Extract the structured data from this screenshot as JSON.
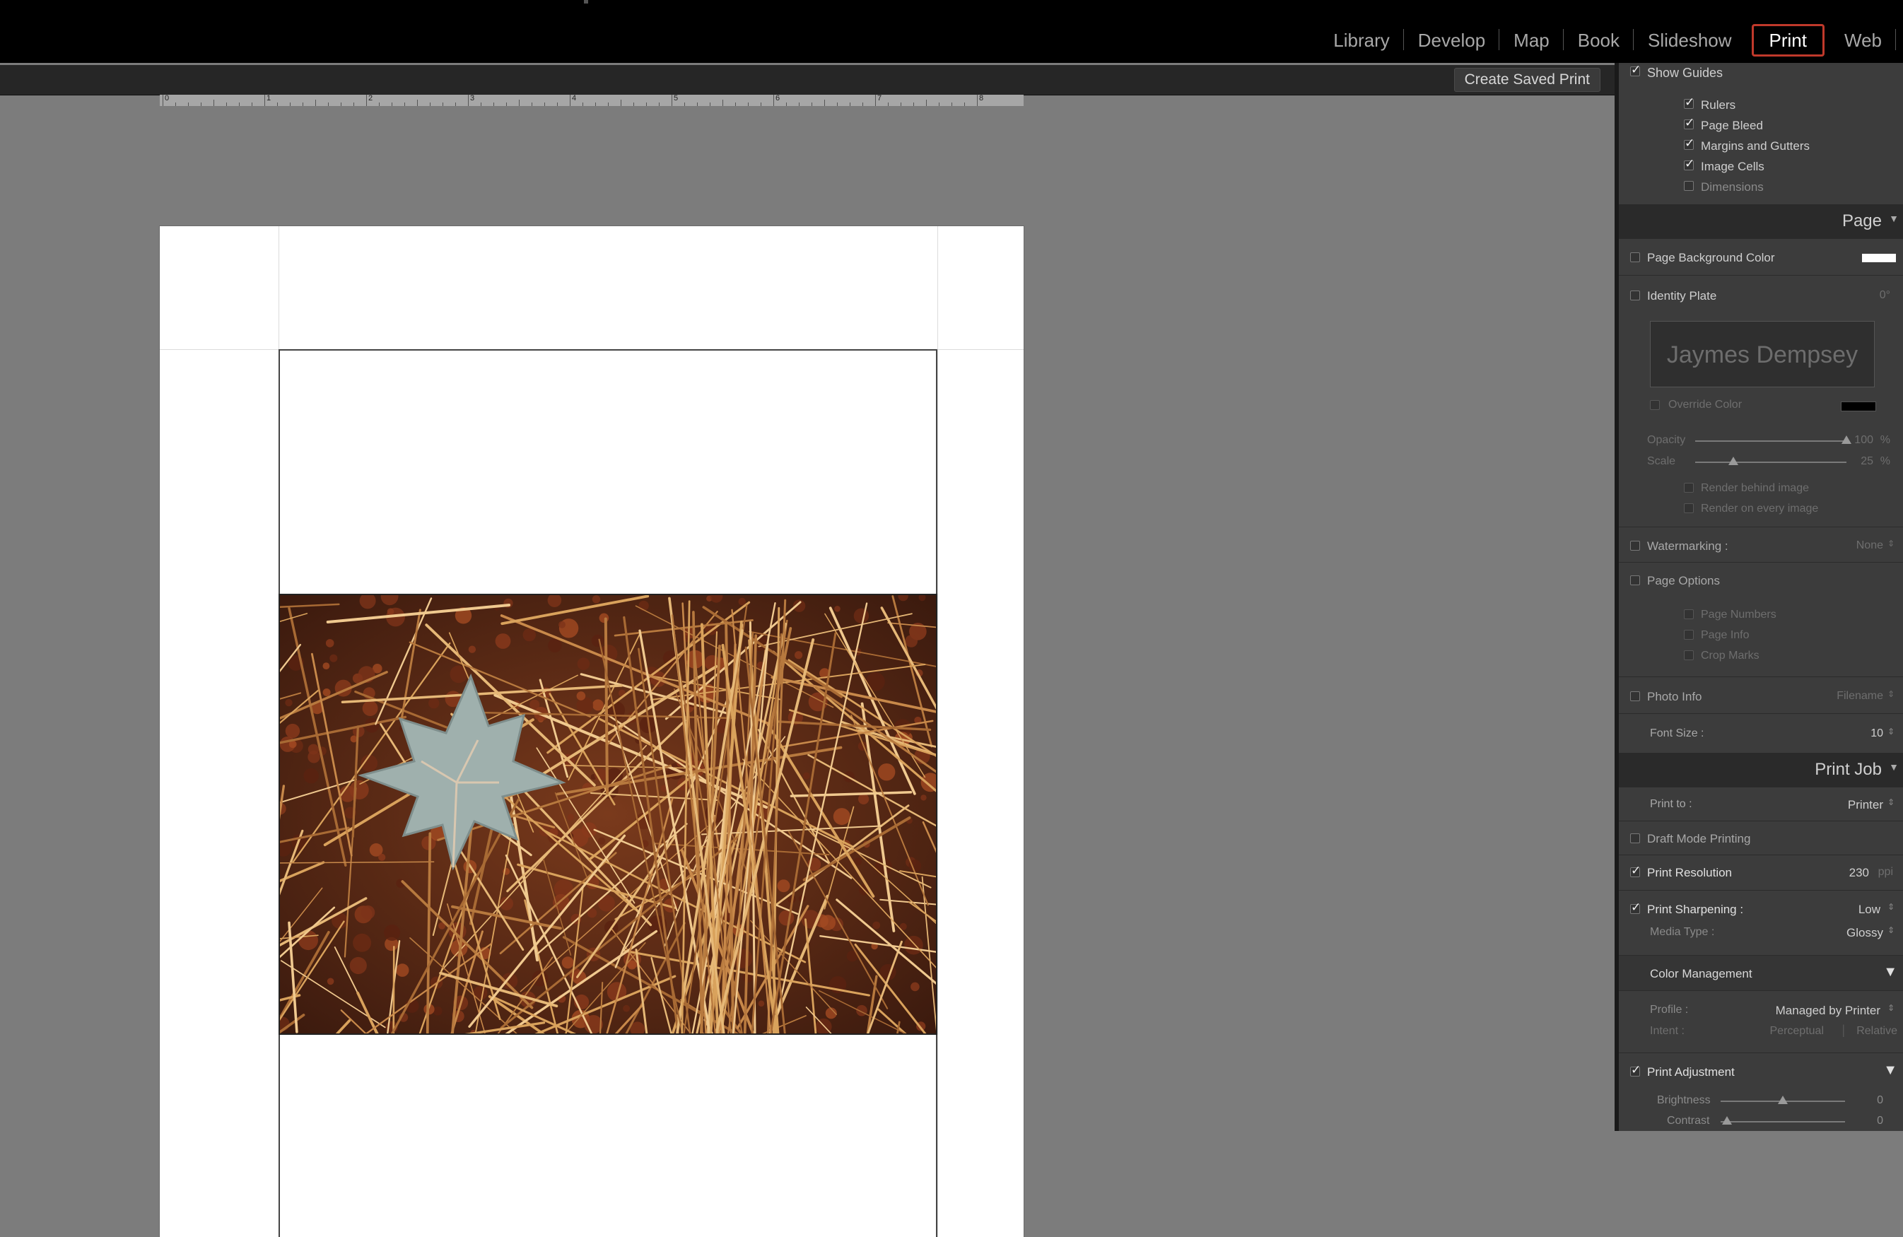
{
  "modules": {
    "items": [
      "Library",
      "Develop",
      "Map",
      "Book",
      "Slideshow",
      "Print",
      "Web"
    ],
    "active": "Print"
  },
  "toolbar": {
    "create_saved_print": "Create Saved Print"
  },
  "ruler": {
    "numbers": [
      "0",
      "1",
      "2",
      "3",
      "4",
      "5",
      "6",
      "7",
      "8"
    ]
  },
  "guides": {
    "show_guides": "Show Guides",
    "rulers": "Rulers",
    "page_bleed": "Page Bleed",
    "margins_and_gutters": "Margins and Gutters",
    "image_cells": "Image Cells",
    "dimensions": "Dimensions"
  },
  "page_panel": {
    "title": "Page",
    "page_background_color": "Page Background Color",
    "page_background_swatch": "#ffffff",
    "identity_plate": "Identity Plate",
    "identity_plate_angle": "0°",
    "identity_plate_text": "Jaymes Dempsey",
    "override_color": "Override Color",
    "override_swatch": "#000000",
    "opacity_label": "Opacity",
    "opacity_value": "100",
    "opacity_unit": "%",
    "opacity_level": 1.0,
    "scale_label": "Scale",
    "scale_value": "25",
    "scale_unit": "%",
    "scale_level": 0.25,
    "render_behind": "Render behind image",
    "render_every": "Render on every image",
    "watermarking": "Watermarking :",
    "watermarking_value": "None",
    "page_options": "Page Options",
    "page_numbers": "Page Numbers",
    "page_info": "Page Info",
    "crop_marks": "Crop Marks",
    "photo_info": "Photo Info",
    "photo_info_value": "Filename",
    "font_size": "Font Size :",
    "font_size_value": "10"
  },
  "print_job": {
    "title": "Print Job",
    "print_to": "Print to :",
    "print_to_value": "Printer",
    "draft_mode": "Draft Mode Printing",
    "print_resolution": "Print Resolution",
    "print_resolution_value": "230",
    "print_resolution_unit": "ppi",
    "print_sharpening": "Print Sharpening :",
    "print_sharpening_value": "Low",
    "media_type": "Media Type :",
    "media_type_value": "Glossy",
    "color_management": "Color Management",
    "profile": "Profile :",
    "profile_value": "Managed by Printer",
    "intent": "Intent :",
    "intent_perceptual": "Perceptual",
    "intent_relative": "Relative",
    "print_adjustment": "Print Adjustment",
    "brightness": "Brightness",
    "brightness_value": "0",
    "brightness_level": 0.5,
    "contrast": "Contrast",
    "contrast_value": "0",
    "contrast_level": 0.05
  },
  "colors": {
    "active_outline": "#c0392b",
    "page": "#ffffff",
    "canvas": "#7c7c7c"
  }
}
